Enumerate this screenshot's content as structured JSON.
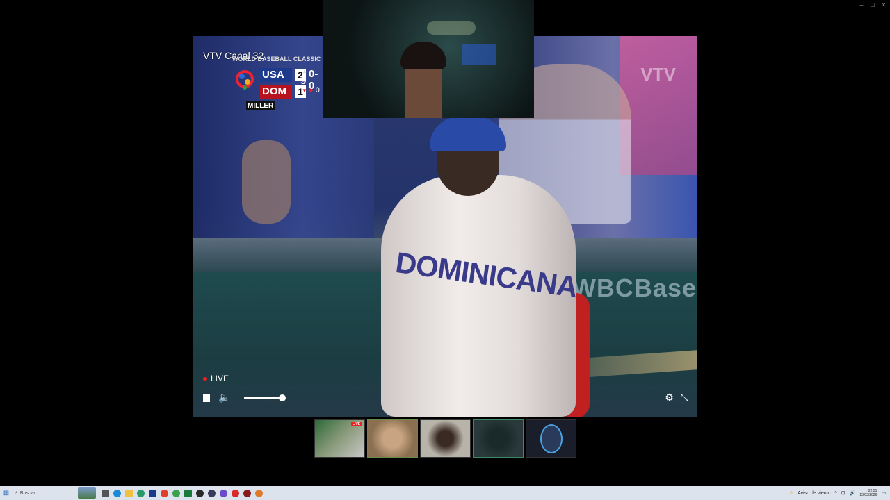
{
  "window": {
    "controls": [
      "–",
      "□",
      "×"
    ]
  },
  "player": {
    "channel_name": "VTV Canal 32",
    "watermark": "VTV",
    "banner_text": "WBCBase",
    "jersey_text": "DOMINICANA",
    "live_label": "LIVE",
    "volume_level": 1.0
  },
  "scorebug": {
    "title": "WORLD BASEBALL CLASSIC - SE",
    "teams": [
      {
        "code": "USA",
        "runs": "2"
      },
      {
        "code": "DOM",
        "runs": "1"
      }
    ],
    "inning": "9",
    "count": "0-0",
    "outs": "0",
    "batter": "MILLER"
  },
  "thumbnails": [
    {
      "name": "stream-1",
      "badge": "LIVE"
    },
    {
      "name": "stream-2"
    },
    {
      "name": "stream-3"
    },
    {
      "name": "stream-4"
    },
    {
      "name": "stream-5"
    }
  ],
  "taskbar": {
    "search_placeholder": "Buscar",
    "notification_text": "Aviso de viento",
    "time": "22:51",
    "date": "13/03/2026"
  },
  "colors": {
    "usa": "#1d3a8c",
    "dom": "#b8121e",
    "live": "#e22222"
  }
}
